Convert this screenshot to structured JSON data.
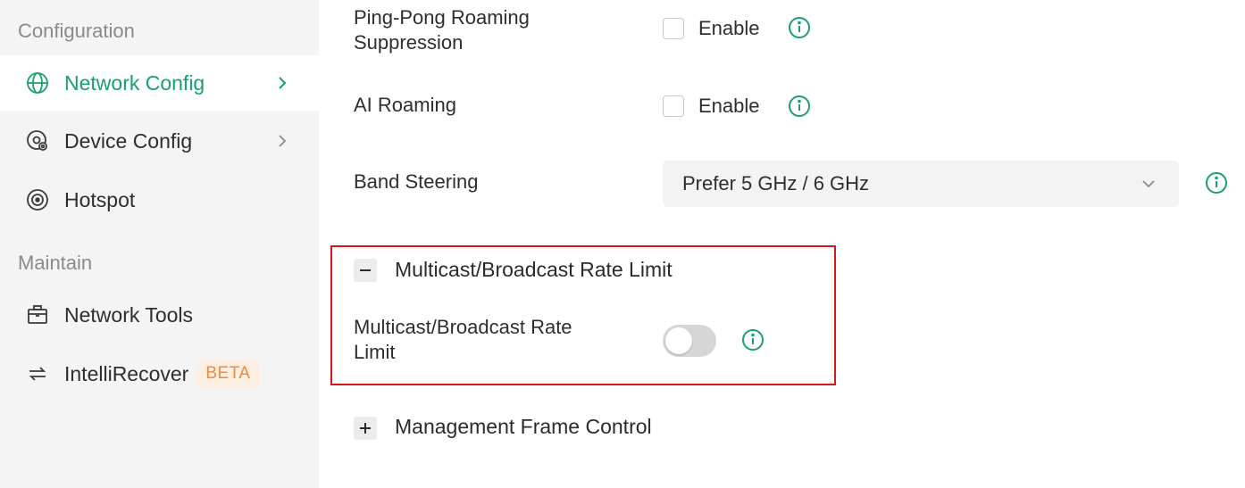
{
  "colors": {
    "accent": "#19a06d",
    "sidebar_bg": "#f4f4f4",
    "beta_bg": "#fdeee2",
    "beta_text": "#f08a3c",
    "highlight_border": "#d9151a"
  },
  "sidebar": {
    "configuration_title": "Configuration",
    "maintain_title": "Maintain",
    "items": [
      {
        "label": "Network Config",
        "icon": "globe-icon",
        "active": true
      },
      {
        "label": "Device Config",
        "icon": "device-gear-icon",
        "active": false
      },
      {
        "label": "Hotspot",
        "icon": "hotspot-icon",
        "active": false
      },
      {
        "label": "Network Tools",
        "icon": "toolbox-icon",
        "active": false
      },
      {
        "label": "IntelliRecover",
        "icon": "sync-icon",
        "active": false,
        "badge": "BETA"
      }
    ]
  },
  "main": {
    "ping_pong": {
      "label_line1": "Ping-Pong Roaming",
      "label_line2": "Suppression",
      "checkbox_label": "Enable",
      "checked": false
    },
    "ai_roaming": {
      "label": "AI Roaming",
      "checkbox_label": "Enable",
      "checked": false
    },
    "band_steering": {
      "label": "Band Steering",
      "value": "Prefer 5 GHz / 6 GHz"
    },
    "multicast_group": {
      "title": "Multicast/Broadcast Rate Limit",
      "expanded": true,
      "toggle_label_line1": "Multicast/Broadcast Rate",
      "toggle_label_line2": "Limit",
      "toggle_on": false
    },
    "management_group": {
      "title": "Management Frame Control",
      "expanded": false
    }
  }
}
